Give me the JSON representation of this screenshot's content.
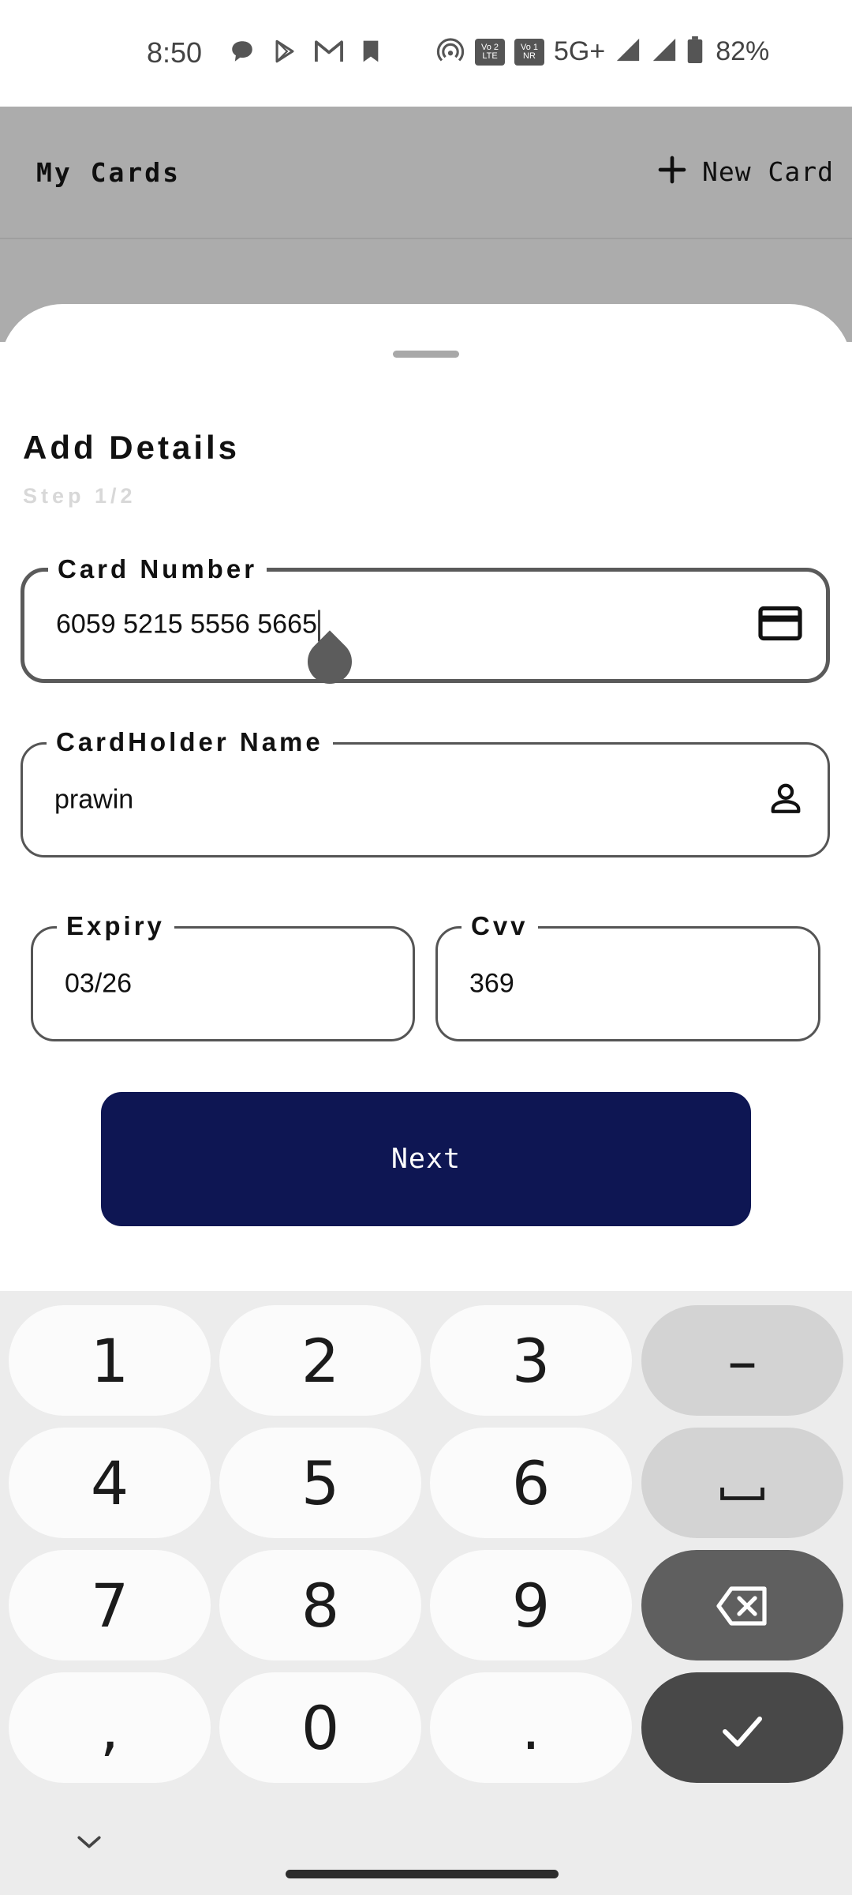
{
  "status_bar": {
    "time": "8:50",
    "network": "5G+",
    "battery": "82%",
    "sim1_badge": "Vo 2 LTE",
    "sim2_badge": "Vo 1 NR",
    "icons": [
      "chat-icon",
      "play-store-icon",
      "gmail-icon",
      "bookmark-icon",
      "hotspot-icon",
      "volte-icon",
      "vonr-icon",
      "signal-icon",
      "signal-icon",
      "battery-icon"
    ]
  },
  "app_bar": {
    "title": "My Cards",
    "new_card_label": "New Card",
    "new_card_icon": "plus-icon"
  },
  "sheet": {
    "title": "Add Details",
    "step": "Step 1/2",
    "card_number": {
      "label": "Card Number",
      "value": "6059 5215 5556 5665",
      "icon": "credit-card-icon"
    },
    "cardholder_name": {
      "label": "CardHolder Name",
      "value": "prawin",
      "icon": "person-icon"
    },
    "expiry": {
      "label": "Expiry",
      "value": "03/26"
    },
    "cvv": {
      "label": "Cvv",
      "value": "369"
    },
    "next_label": "Next"
  },
  "keyboard": {
    "rows": [
      [
        "1",
        "2",
        "3",
        "–"
      ],
      [
        "4",
        "5",
        "6",
        "space"
      ],
      [
        "7",
        "8",
        "9",
        "backspace"
      ],
      [
        ",",
        "0",
        ".",
        "done"
      ]
    ],
    "collapse_icon": "chevron-down-icon"
  },
  "colors": {
    "primary_button": "#0e1653",
    "scrim": "#acacac",
    "keyboard_bg": "#ececec"
  }
}
